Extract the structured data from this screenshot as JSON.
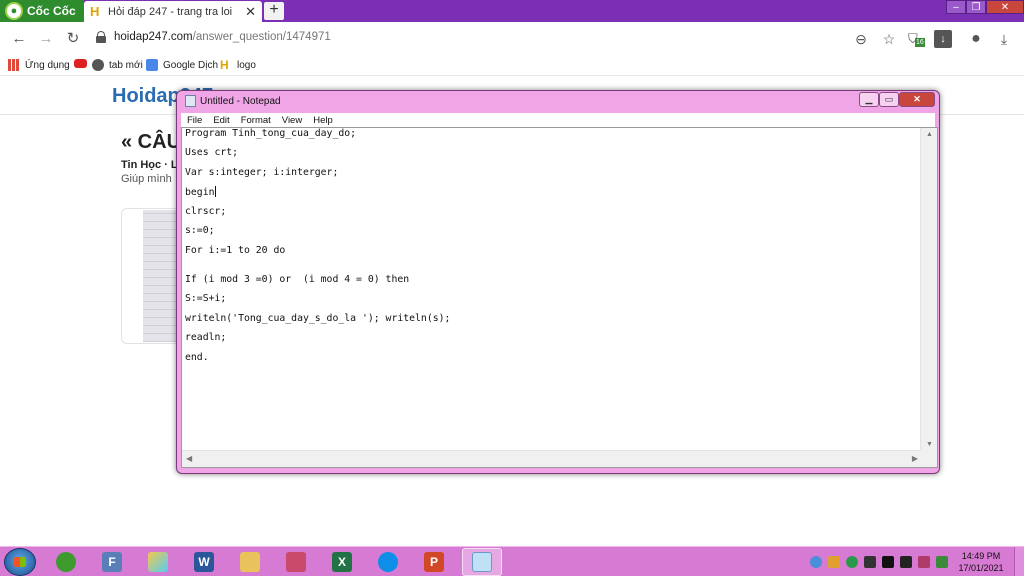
{
  "browser": {
    "brand": "Cốc Cốc",
    "tab": {
      "title": "Hỏi đáp 247 - trang tra loi",
      "favicon": "H",
      "close": "✕"
    },
    "new_tab": "+",
    "window_controls": {
      "minimize": "–",
      "maximize": "❐",
      "close": "✕"
    },
    "url": {
      "host": "hoidap247.com",
      "path": "/answer_question/1474971"
    },
    "bookmarks": [
      {
        "label": "Ứng dụng",
        "icon": "apps-grid-icon"
      },
      {
        "label": "",
        "icon": "youtube-icon"
      },
      {
        "label": "tab mới",
        "icon": "globe-icon"
      },
      {
        "label": "Google Dịch",
        "icon": "google-translate-icon"
      },
      {
        "label": "logo",
        "icon": "hoidap-logo-icon"
      }
    ],
    "extension_badge": "16"
  },
  "page": {
    "site_logo": "Hoidap247",
    "question_title": "« CÂU",
    "meta": "Tin Học · Lớ",
    "subtitle": "Giúp mình"
  },
  "notepad": {
    "title": "Untitled - Notepad",
    "menu": [
      "File",
      "Edit",
      "Format",
      "View",
      "Help"
    ],
    "lines": [
      "Program Tinh_tong_cua_day_do;",
      "Uses crt;",
      "Var s:integer; i:interger;",
      "begin",
      "clrscr;",
      "s:=0;",
      "For i:=1 to 20 do",
      "",
      "If (i mod 3 =0) or  (i mod 4 = 0) then",
      "S:=S+i;",
      "writeln('Tong_cua_day_s_do_la '); writeln(s);",
      "readln;",
      "end."
    ]
  },
  "taskbar": {
    "apps": [
      {
        "name": "coccoc-browser",
        "glyph": ""
      },
      {
        "name": "font-viewer",
        "glyph": "F"
      },
      {
        "name": "paint",
        "glyph": ""
      },
      {
        "name": "word",
        "glyph": "W"
      },
      {
        "name": "file-explorer",
        "glyph": ""
      },
      {
        "name": "network",
        "glyph": ""
      },
      {
        "name": "excel",
        "glyph": "X"
      },
      {
        "name": "teamviewer",
        "glyph": ""
      },
      {
        "name": "powerpoint",
        "glyph": "P"
      },
      {
        "name": "notepad",
        "glyph": ""
      }
    ],
    "time": "14:49 PM",
    "date": "17/01/2021"
  },
  "colors": {
    "tabbar": "#7b2fb5",
    "taskbar": "#d77ad3",
    "notepad_frame": "#f0a6e6",
    "coccoc_green": "#2e8b2e"
  }
}
